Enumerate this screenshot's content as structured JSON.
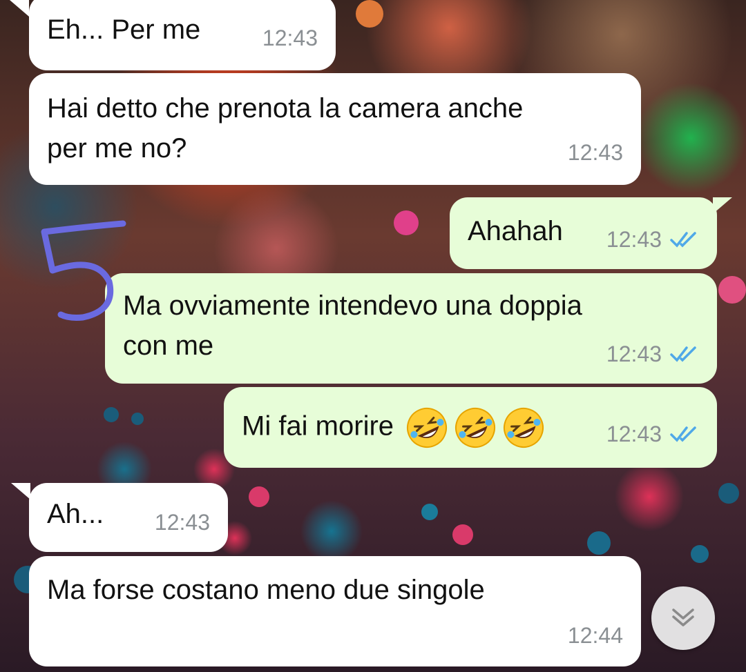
{
  "colors": {
    "incoming_bubble": "#ffffff",
    "outgoing_bubble": "#e7fdd8",
    "read_ticks": "#4fa8e8",
    "timestamp": "#8a8f93",
    "annotation": "#6a6ae0"
  },
  "annotation": {
    "text": "5"
  },
  "messages": [
    {
      "direction": "in",
      "text": "Eh... Per me",
      "time": "12:43"
    },
    {
      "direction": "in",
      "text_line1": "Hai detto che prenota la camera anche",
      "text_line2": "per me no?",
      "time": "12:43"
    },
    {
      "direction": "out",
      "text": "Ahahah",
      "time": "12:43",
      "status_icon": "double-check-read-icon"
    },
    {
      "direction": "out",
      "text_line1": "Ma ovviamente intendevo una doppia",
      "text_line2": "con me",
      "time": "12:43",
      "status_icon": "double-check-read-icon"
    },
    {
      "direction": "out",
      "text": "Mi fai morire",
      "emoji": [
        "rolling-on-floor-laughing-icon",
        "rolling-on-floor-laughing-icon",
        "rolling-on-floor-laughing-icon"
      ],
      "time": "12:43",
      "status_icon": "double-check-read-icon"
    },
    {
      "direction": "in",
      "text": "Ah...",
      "time": "12:43"
    },
    {
      "direction": "in",
      "text": "Ma forse costano meno due singole",
      "time": "12:44"
    }
  ],
  "scroll_button": {
    "icon": "double-chevron-down-icon"
  }
}
